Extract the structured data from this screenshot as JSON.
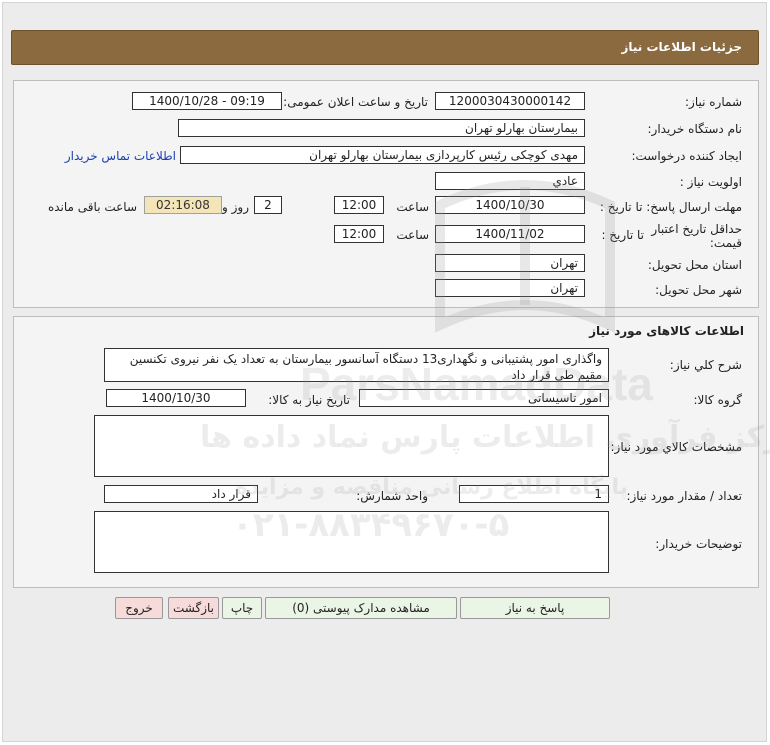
{
  "header": {
    "title": "جزئیات اطلاعات نیاز"
  },
  "need_info": {
    "need_number": {
      "label": "شماره نیاز:",
      "value": "1200030430000142"
    },
    "announce_datetime": {
      "label": "تاریخ و ساعت اعلان عمومی:",
      "value": "1400/10/28 - 09:19"
    },
    "buyer_org": {
      "label": "نام دستگاه خریدار:",
      "value": "بیمارستان بهارلو تهران"
    },
    "requester": {
      "label": "ایجاد کننده درخواست:",
      "value": "مهدی کوچکی  رئیس کارپردازی بیمارستان بهارلو تهران"
    },
    "contact_link": "اطلاعات تماس خریدار",
    "priority": {
      "label": "اولویت نیاز :",
      "value": "عادي"
    },
    "reply_deadline": {
      "label": "مهلت ارسال پاسخ: تا تاریخ :",
      "date": "1400/10/30",
      "time_label": "ساعت",
      "time": "12:00",
      "days": "2",
      "days_label": "روز و",
      "remaining": "02:16:08",
      "remaining_label": "ساعت باقی مانده"
    },
    "price_validity": {
      "label": "حداقل تاریخ اعتبار قیمت:",
      "to_date_label": "تا تاریخ :",
      "date": "1400/11/02",
      "time_label": "ساعت",
      "time": "12:00"
    },
    "delivery_province": {
      "label": "استان محل تحویل:",
      "value": "تهران"
    },
    "delivery_city": {
      "label": "شهر محل تحویل:",
      "value": "تهران"
    }
  },
  "goods_info": {
    "title": "اطلاعات کالاهای مورد نیاز",
    "summary": {
      "label": "شرح کلي نياز:",
      "value": "واگذاری امور پشتیبانی و نگهداری13 دستگاه آسانسور بیمارستان به تعداد یک نفر نیروی تکنسین مقیم طی قرار داد"
    },
    "goods_group": {
      "label": "گروه کالا:",
      "value": "امور تاسیساتی"
    },
    "need_date": {
      "label": "تاریخ نیاز به کالا:",
      "value": "1400/10/30"
    },
    "specs": {
      "label": "مشخصات کالاي مورد نياز:",
      "value": ""
    },
    "quantity": {
      "label": "تعداد / مقدار مورد نیاز:",
      "value": "1"
    },
    "unit": {
      "label": "واحد شمارش:",
      "value": "قرار داد"
    },
    "buyer_notes": {
      "label": "توضیحات خریدار:",
      "value": ""
    }
  },
  "buttons": {
    "reply": "پاسخ به نیاز",
    "attachments": "مشاهده مدارک پیوستی (0)",
    "print": "چاپ",
    "back": "بازگشت",
    "exit": "خروج"
  },
  "watermark": {
    "brand": "ParsNamadData",
    "line1": "مرکز فرآوری اطلاعات پارس نماد داده ها",
    "line2": "پایگاه اطلاع رسانی مناقصه و مزایده",
    "phone": "۰۲۱-۸۸۳۴۹۶۷۰-۵"
  },
  "colors": {
    "header_bg": "#8a6a3e",
    "link": "#1a3fb0",
    "amber": "#f3e5b8",
    "btn_green": "#eaf5e6",
    "btn_pink": "#f7dada"
  }
}
